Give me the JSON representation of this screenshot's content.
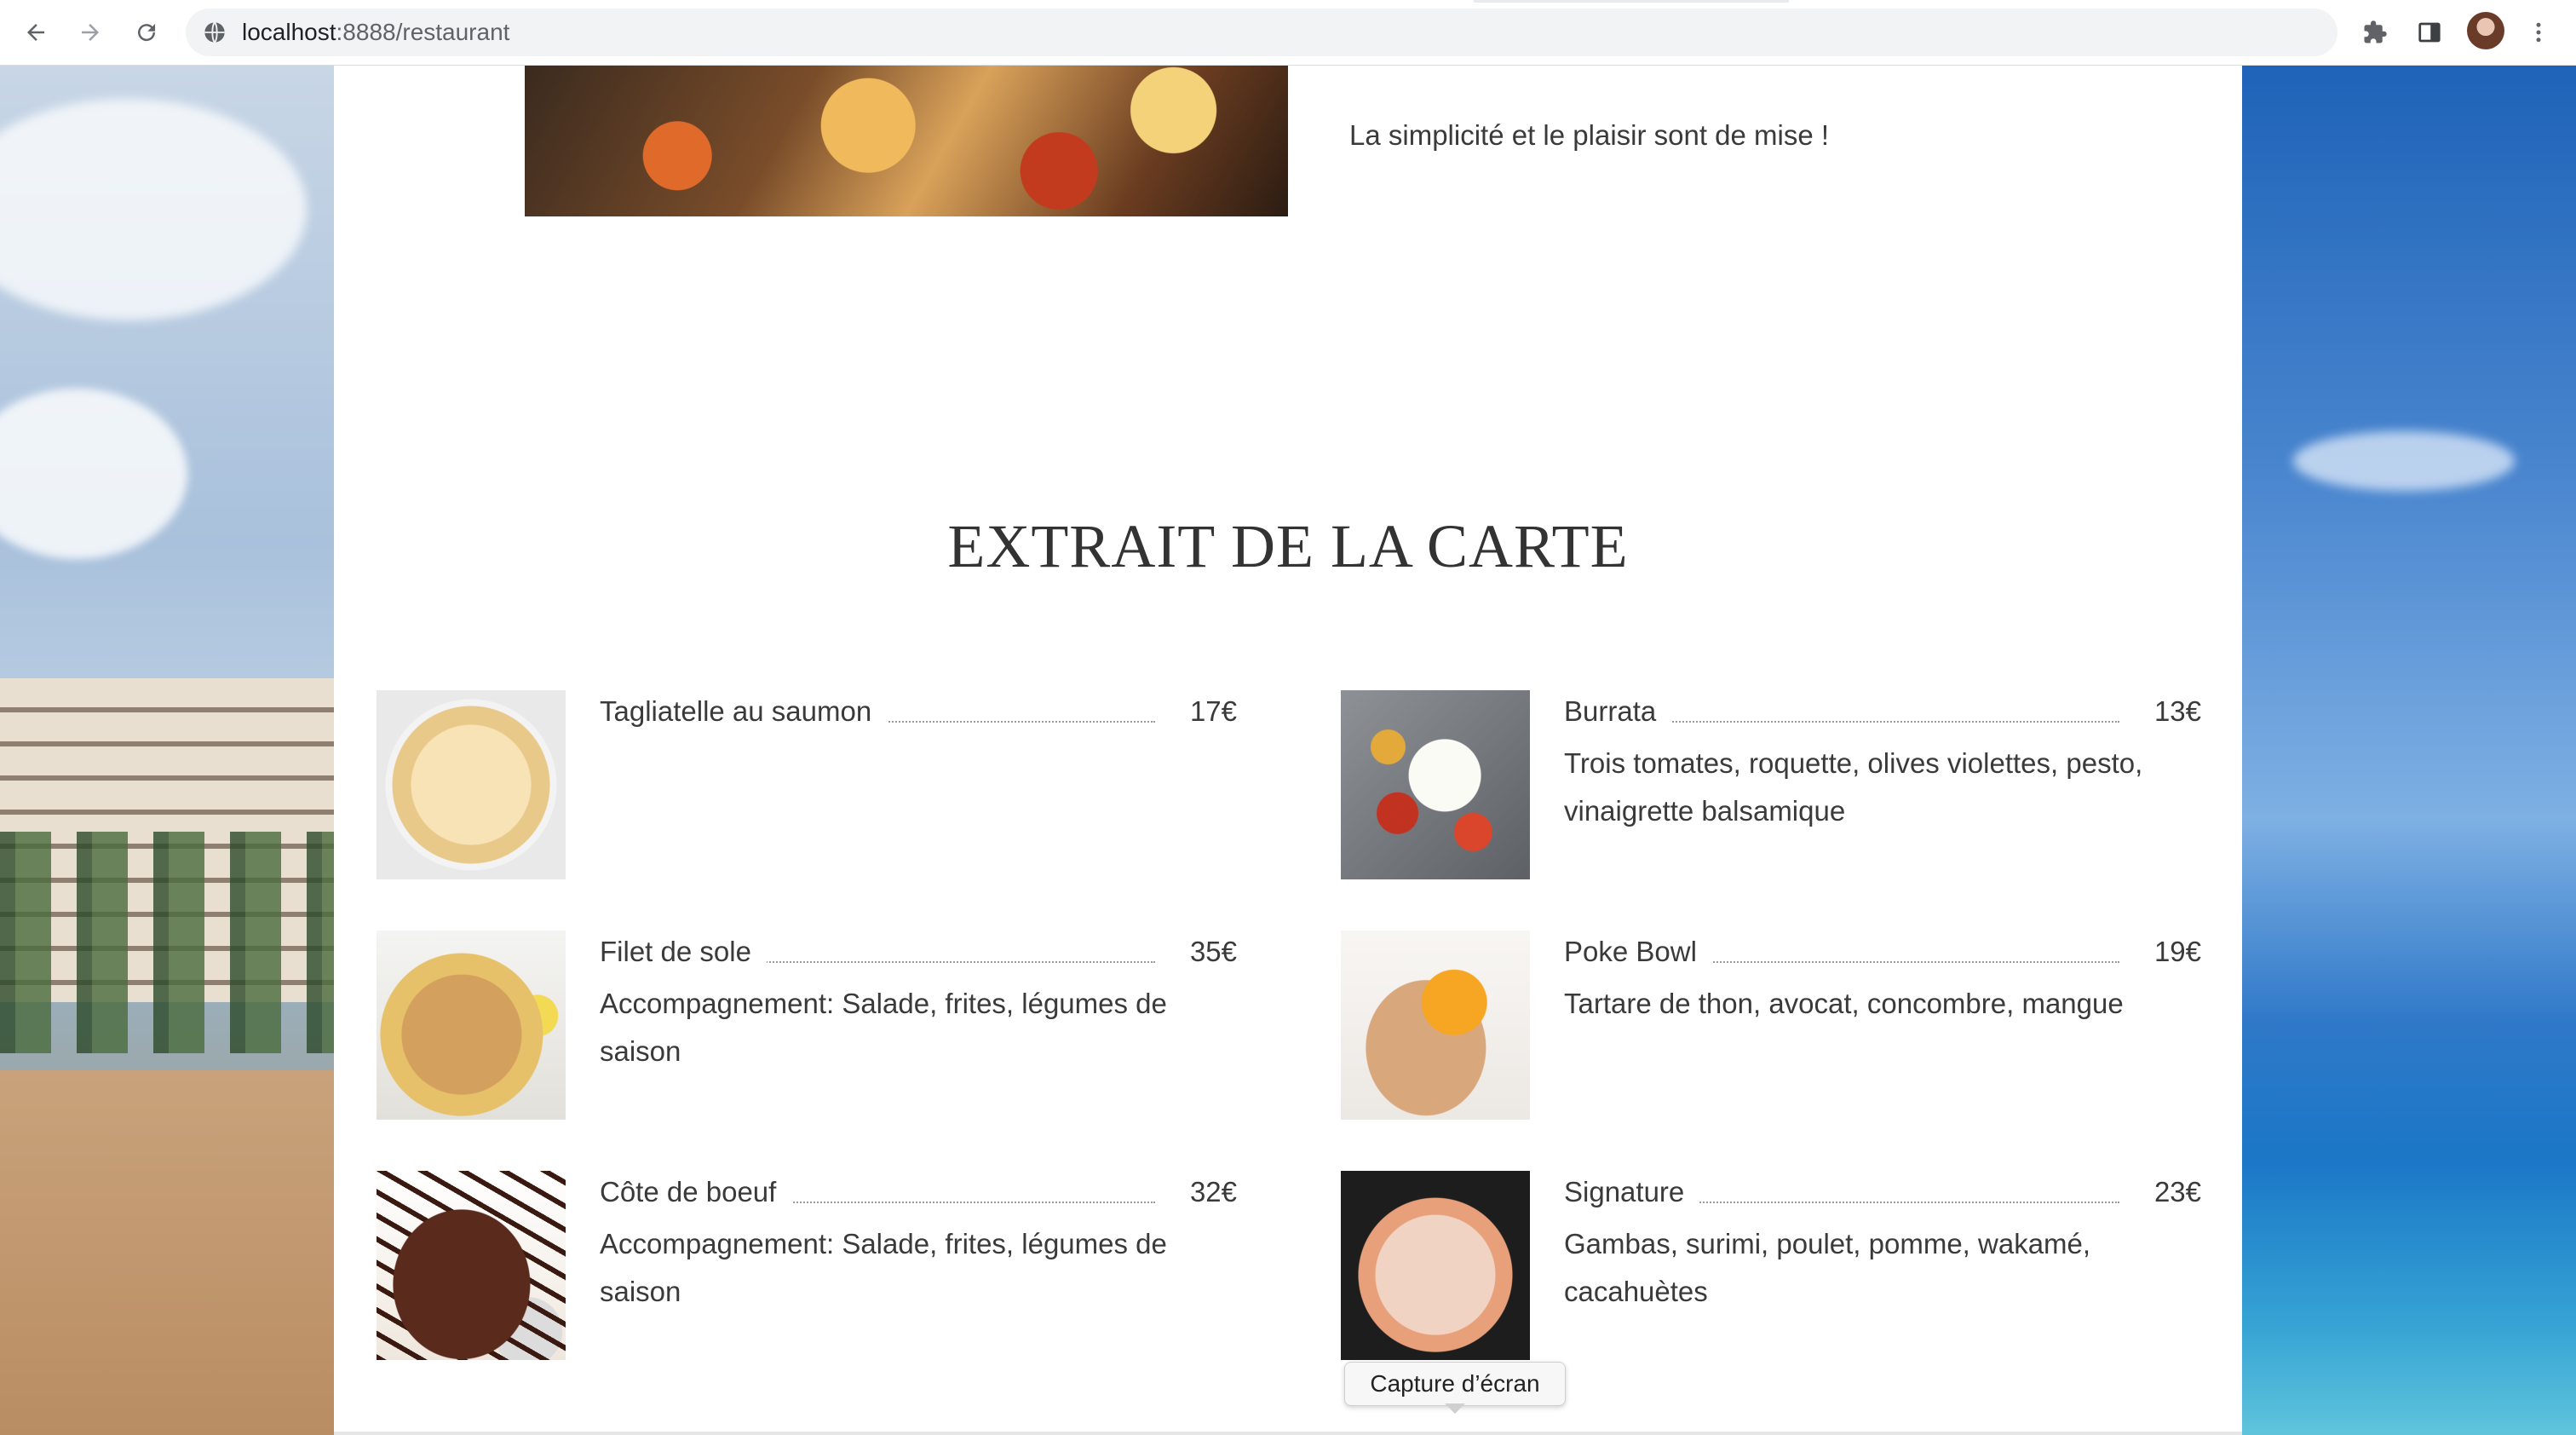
{
  "browser": {
    "url_host": "localhost",
    "url_path": ":8888/restaurant",
    "icons": [
      "back-arrow-icon",
      "forward-arrow-icon",
      "reload-icon",
      "site-info-icon",
      "extensions-icon",
      "side-panel-icon",
      "profile-avatar",
      "more-menu-icon"
    ]
  },
  "intro": {
    "text": "La simplicité et le plaisir sont de mise !"
  },
  "menu": {
    "title": "EXTRAIT DE LA CARTE",
    "items": [
      {
        "name": "Tagliatelle au saumon",
        "price": "17€",
        "desc": ""
      },
      {
        "name": "Burrata",
        "price": "13€",
        "desc": "Trois tomates, roquette, olives violettes, pesto, vinaigrette balsamique"
      },
      {
        "name": "Filet de sole",
        "price": "35€",
        "desc": "Accompagnement: Salade, frites, légumes de saison"
      },
      {
        "name": "Poke Bowl",
        "price": "19€",
        "desc": "Tartare de thon, avocat, concombre, mangue"
      },
      {
        "name": "Côte de boeuf",
        "price": "32€",
        "desc": "Accompagnement: Salade, frites, légumes de saison"
      },
      {
        "name": "Signature",
        "price": "23€",
        "desc": "Gambas, surimi, poulet, pomme, wakamé, cacahuètes"
      }
    ]
  },
  "tooltip": {
    "text": "Capture d’écran"
  },
  "colors": {
    "page_bg": "#ffffff",
    "text": "#3a3a3a",
    "toolbar_bg": "#ffffff",
    "omnibox_bg": "#f1f3f4"
  }
}
